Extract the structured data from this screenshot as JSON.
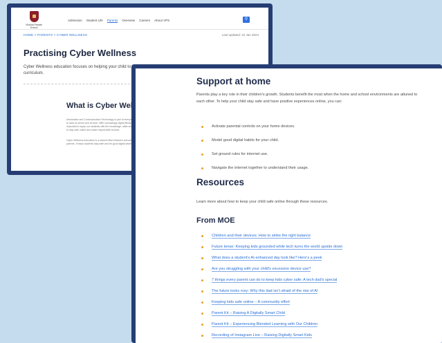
{
  "colors": {
    "accent": "#2a6fd6",
    "frame": "#253d73",
    "bullet": "#e6a12b"
  },
  "back_page": {
    "school_name": "Victoria Parade School",
    "nav": {
      "items": [
        "Admission",
        "Student Life",
        "Parents",
        "Overview",
        "Careers",
        "About VPS"
      ],
      "active_index": 2,
      "search_icon": "search-icon"
    },
    "breadcrumb": "HOME  >  PARENTS  >  CYBER WELLNESS",
    "updated": "Last updated: 10 Jan 2024",
    "title": "Practising Cyber Wellness",
    "intro": "Cyber Wellness education focuses on helping your child to be a responsible digital learner. Learn more about the programme and curriculum.",
    "section_title": "What is Cyber Wel",
    "paragraphs": [
      "Information and Communication Technology is part of everyday life. It is used at school and at work. With increasingly digital lifestyles, it is important to equip our students with the knowledge, skills and values to stay safe online and make responsible choices.",
      "Cyber Wellness education is a shared effort between schools and parents. It helps students stay safe and be good digital citizens."
    ]
  },
  "front_page": {
    "support": {
      "title": "Support at home",
      "intro": "Parents play a key role in their children's growth. Students benefit the most when the home and school environments are attuned to each other. To help your child stay safe and have positive experiences online, you can:",
      "tips": [
        "Activate parental controls on your home devices.",
        "Model good digital habits for your child.",
        "Set ground rules for internet use.",
        "Navigate the internet together to understand their usage."
      ]
    },
    "resources": {
      "title": "Resources",
      "intro": "Learn more about how to keep your child safe online through these resources.",
      "from_moe": {
        "title": "From MOE",
        "links": [
          "Children and their devices: How to strike the right balance",
          "Future tense: Keeping kids grounded while tech turns the world upside down",
          "What does a student's AI-enhanced day look like? Here's a peek",
          "Are you struggling with your child's excessive device use?",
          "7 things every parent can do to keep kids cyber safe: A tech dad's special",
          "The future looks rosy: Why this dad isn't afraid of the rise of AI",
          "Keeping kids safe online – A community effort",
          "Parent Kit – Raising A Digitally Smart Child",
          "Parent Kit – Experiencing Blended Learning with Our Children",
          "Recording of Instagram Live – Raising Digitally Smart Kids"
        ]
      }
    }
  }
}
